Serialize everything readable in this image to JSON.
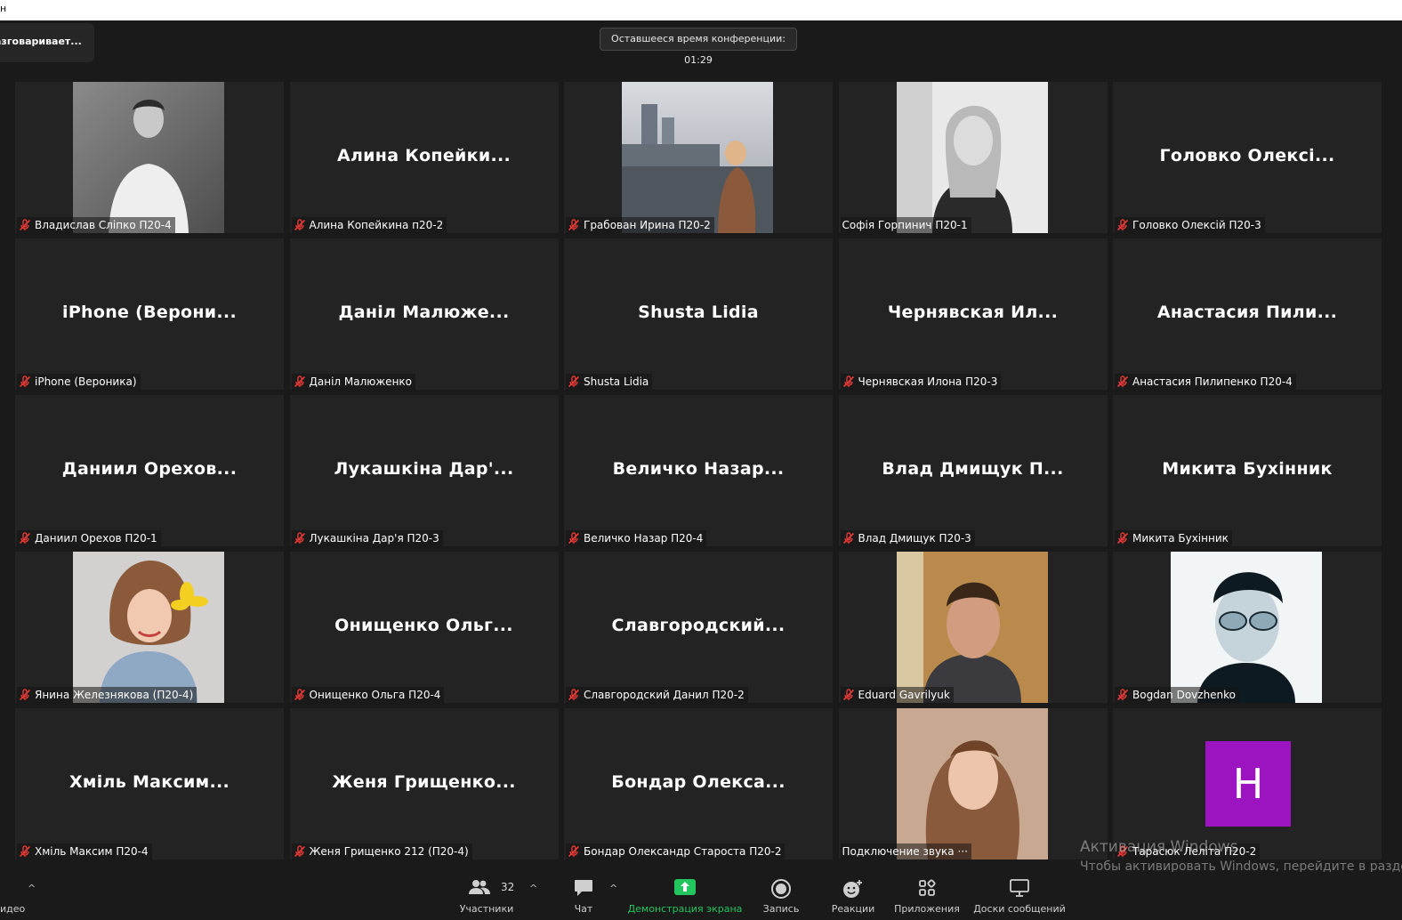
{
  "titlebar": {
    "text": "н"
  },
  "speaking": {
    "text": "азговаривает..."
  },
  "timer": {
    "text": "Оставшееся время конференции: 01:29"
  },
  "tiles": [
    {
      "type": "photo",
      "photo": "man-white-shirt",
      "label": "Владислав Слiпко П20-4",
      "muted": true
    },
    {
      "type": "name",
      "big": "Алина  Копейки...",
      "label": "Алина Копейкина п20-2",
      "muted": true
    },
    {
      "type": "photo",
      "photo": "woman-city",
      "label": "Грабован Ирина П20-2",
      "muted": true
    },
    {
      "type": "photo",
      "photo": "woman-bw",
      "label": "Софія Горпинич П20-1",
      "muted": false
    },
    {
      "type": "name",
      "big": "Головко  Олексі...",
      "label": "Головко Олексій П20-3",
      "muted": true
    },
    {
      "type": "name",
      "big": "iPhone  (Верони...",
      "label": "iPhone (Вероника)",
      "muted": true
    },
    {
      "type": "name",
      "big": "Даніл  Малюже...",
      "label": "Даніл Малюженко",
      "muted": true
    },
    {
      "type": "name",
      "big": "Shusta  Lidia",
      "label": "Shusta Lidia",
      "muted": true
    },
    {
      "type": "name",
      "big": "Чернявская  Ил...",
      "label": "Чернявская Илона П20-3",
      "muted": true
    },
    {
      "type": "name",
      "big": "Анастасия  Пили...",
      "label": "Анастасия Пилипенко П20-4",
      "muted": true
    },
    {
      "type": "name",
      "big": "Даниил  Орехов...",
      "label": "Даниил Орехов П20-1",
      "muted": true
    },
    {
      "type": "name",
      "big": "Лукашкіна  Дар'...",
      "label": "Лукашкіна Дар'я П20-3",
      "muted": true
    },
    {
      "type": "name",
      "big": "Величко  Назар...",
      "label": "Величко Назар П20-4",
      "muted": true
    },
    {
      "type": "name",
      "big": "Влад  Дмищук  П...",
      "label": "Влад Дмищук П20-3",
      "muted": true
    },
    {
      "type": "name",
      "big": "Микита  Бухінник",
      "label": "Микита Бухінник",
      "muted": true
    },
    {
      "type": "photo",
      "photo": "woman-flower",
      "label": "Янина Железнякова (П20-4)",
      "muted": true
    },
    {
      "type": "name",
      "big": "Онищенко  Ольг...",
      "label": "Онищенко Ольга П20-4",
      "muted": true
    },
    {
      "type": "name",
      "big": "Славгородский...",
      "label": "Славгородский Данил П20-2",
      "muted": true
    },
    {
      "type": "photo",
      "photo": "young-man",
      "label": "Eduard Gavrilyuk",
      "muted": true
    },
    {
      "type": "photo",
      "photo": "man-sunglasses",
      "label": "Bogdan Dovzhenko",
      "muted": true
    },
    {
      "type": "name",
      "big": "Хміль  Максим...",
      "label": "Хміль Максим П20-4",
      "muted": true
    },
    {
      "type": "name",
      "big": "Женя  Грищенко...",
      "label": "Женя Грищенко 212 (П20-4)",
      "muted": true
    },
    {
      "type": "name",
      "big": "Бондар  Олекса...",
      "label": "Бондар Олександр Староста П20-2",
      "muted": true
    },
    {
      "type": "photo",
      "photo": "woman-portrait",
      "label": "Подключение звука ···",
      "muted": false
    },
    {
      "type": "avatar",
      "initial": "Н",
      "avatar_color": "#9b14c0",
      "label": "Тарасюк Леліта П20-2",
      "muted": true
    }
  ],
  "watermark": {
    "line1": "Активация Windows",
    "line2": "Чтобы активировать Windows, перейдите в раздел"
  },
  "toolbar": {
    "video_label": "идео",
    "participants_label": "Участники",
    "participants_count": "32",
    "chat_label": "Чат",
    "share_label": "Демонстрация экрана",
    "record_label": "Запись",
    "reactions_label": "Реакции",
    "apps_label": "Приложения",
    "whiteboard_label": "Доски сообщений",
    "share_color": "#22c55e"
  }
}
